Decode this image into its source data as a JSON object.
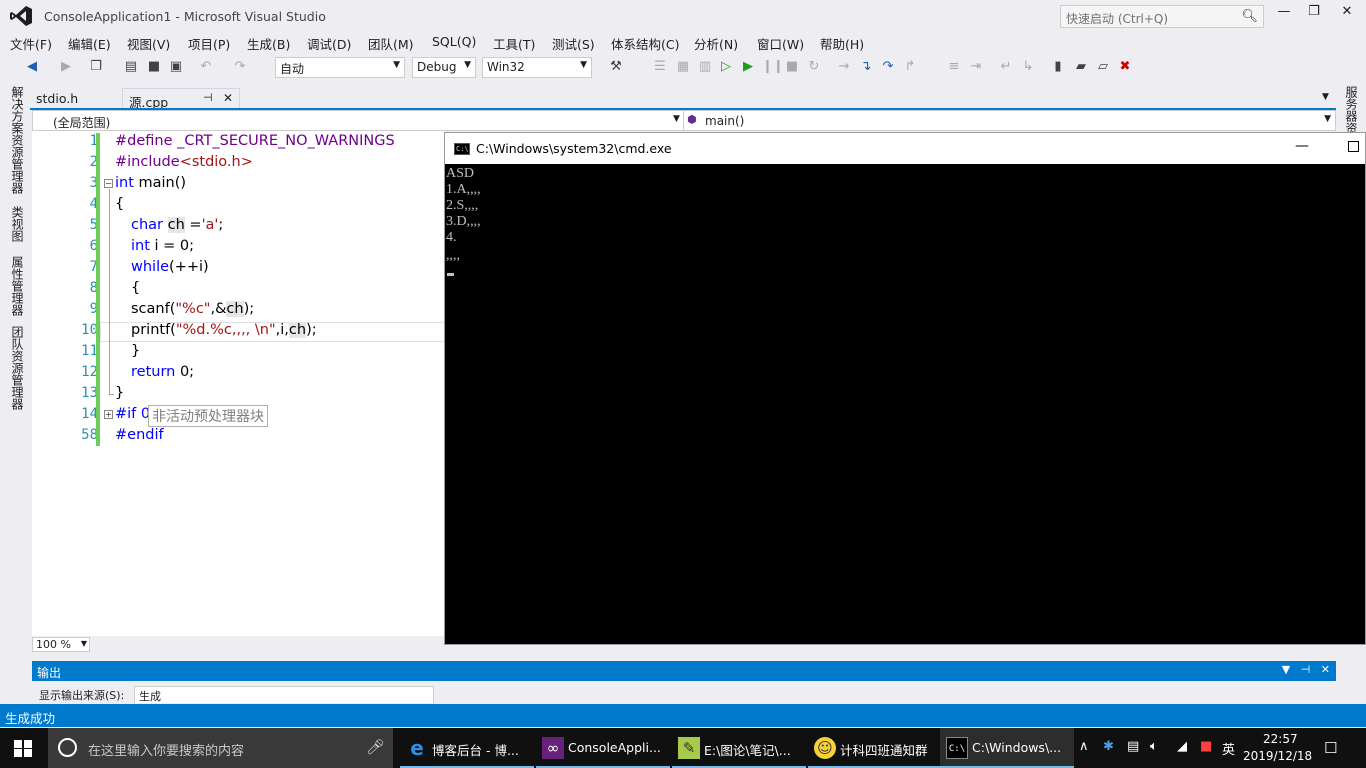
{
  "window": {
    "title": "ConsoleApplication1 - Microsoft Visual Studio",
    "quick_launch_placeholder": "快速启动 (Ctrl+Q)"
  },
  "menu": [
    "文件(F)",
    "编辑(E)",
    "视图(V)",
    "项目(P)",
    "生成(B)",
    "调试(D)",
    "团队(M)",
    "SQL(Q)",
    "工具(T)",
    "测试(S)",
    "体系结构(C)",
    "分析(N)",
    "窗口(W)",
    "帮助(H)"
  ],
  "toolbar": {
    "solution_config_auto": "自动",
    "configuration": "Debug",
    "platform": "Win32"
  },
  "left_tabs": [
    "解决方案资源管理器",
    "类视图",
    "属性管理器",
    "团队资源管理器"
  ],
  "right_tabs": [
    "服务器资"
  ],
  "tabs": {
    "stdio": "stdio.h",
    "source": "源.cpp"
  },
  "nav": {
    "scope": "(全局范围)",
    "function": "main()"
  },
  "editor": {
    "line_numbers": [
      "1",
      "2",
      "3",
      "4",
      "5",
      "6",
      "7",
      "8",
      "9",
      "10",
      "11",
      "12",
      "13",
      "14",
      "58"
    ],
    "lines": [
      [
        "#define",
        " _CRT_SECURE_NO_WARNINGS"
      ],
      [
        "#include",
        "<stdio.h>"
      ],
      [
        "int",
        " main()"
      ],
      [
        "{"
      ],
      [
        "char",
        " ",
        "ch",
        " =",
        "'a'",
        ";"
      ],
      [
        "int",
        " i = 0;"
      ],
      [
        "while",
        "(++i)"
      ],
      [
        "{"
      ],
      [
        "scanf(",
        "\"%c\"",
        ",&",
        "ch",
        ");"
      ],
      [
        "printf(",
        "\"%d.%c,,,, \\n\"",
        ",i,",
        "ch",
        ");"
      ],
      [
        "}"
      ],
      [
        "return",
        " 0;"
      ],
      [
        "}"
      ],
      [
        "#if 0",
        "非活动预处理器块"
      ],
      [
        "#endif"
      ]
    ],
    "zoom": "100 %"
  },
  "output": {
    "title": "输出",
    "source_label": "显示输出来源(S):",
    "source_value": "生成"
  },
  "status": {
    "text": "生成成功"
  },
  "console": {
    "title": "C:\\Windows\\system32\\cmd.exe",
    "lines": [
      "ASD",
      "1.A,,,,",
      "2.S,,,,",
      "3.D,,,,",
      "4.",
      ",,,,"
    ]
  },
  "taskbar": {
    "search_placeholder": "在这里输入你要搜索的内容",
    "apps": [
      {
        "label": "博客后台 - 博...",
        "icon": "edge-icon"
      },
      {
        "label": "ConsoleAppli...",
        "icon": "visual-studio-icon"
      },
      {
        "label": "E:\\图论\\笔记\\...",
        "icon": "notepad-icon"
      },
      {
        "label": "计科四班通知群",
        "icon": "qq-group-icon"
      },
      {
        "label": "C:\\Windows\\...",
        "icon": "cmd-icon"
      }
    ],
    "ime": "英",
    "time": "22:57",
    "date": "2019/12/18"
  },
  "colors": {
    "accent": "#007acc",
    "keyword": "#0000ff",
    "preprocessor": "#6f008a",
    "string": "#a31515",
    "line_number": "#2b91af"
  }
}
